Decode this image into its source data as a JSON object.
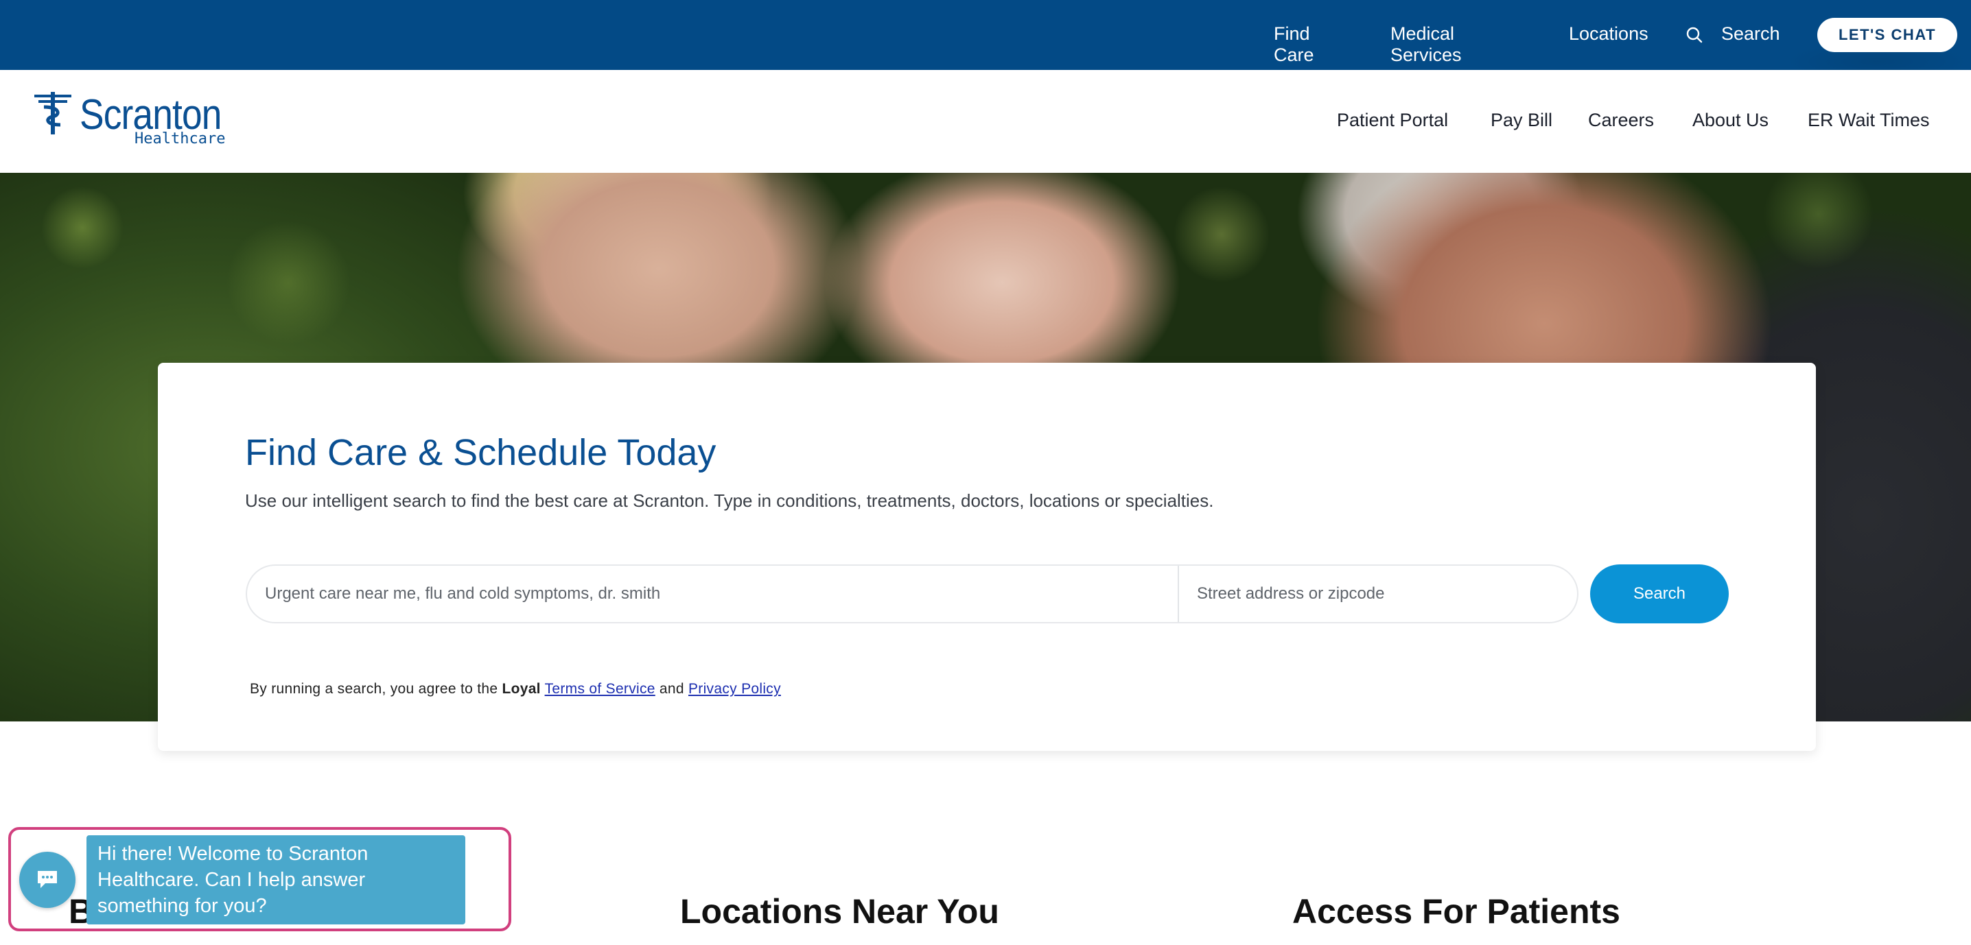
{
  "topbar": {
    "find_care": "Find Care",
    "medical_services": "Medical Services",
    "locations": "Locations",
    "search": "Search",
    "chat_button": "LET'S CHAT"
  },
  "header": {
    "logo_name": "Scranton",
    "logo_sub": "Healthcare",
    "nav": {
      "patient_portal": "Patient Portal",
      "pay_bill": "Pay Bill",
      "careers": "Careers",
      "about_us": "About Us",
      "er_wait_times": "ER Wait Times"
    }
  },
  "search_card": {
    "title": "Find Care & Schedule Today",
    "description": "Use our intelligent search to find the best care at Scranton. Type in conditions, treatments, doctors, locations or specialties.",
    "care_placeholder": "Urgent care near me, flu and cold symptoms, dr. smith",
    "zip_placeholder": "Street address or zipcode",
    "search_button": "Search",
    "terms_prefix": "By running a search, you agree to the ",
    "terms_brand": "Loyal",
    "terms_link": "Terms of Service",
    "terms_and": " and ",
    "privacy_link": "Privacy Policy"
  },
  "sections": {
    "best_doctors": "Best Doctors",
    "locations_near_you": "Locations Near You",
    "access_for_patients": "Access For Patients"
  },
  "chat_widget": {
    "message": "Hi there! Welcome to Scranton Healthcare. Can I help answer something for you?"
  },
  "colors": {
    "topbar_bg": "#034a86",
    "brand_blue": "#0a4f92",
    "search_button": "#0b93d6",
    "chat_bubble": "#4aa8cc",
    "highlight_frame": "#d13f7e"
  }
}
